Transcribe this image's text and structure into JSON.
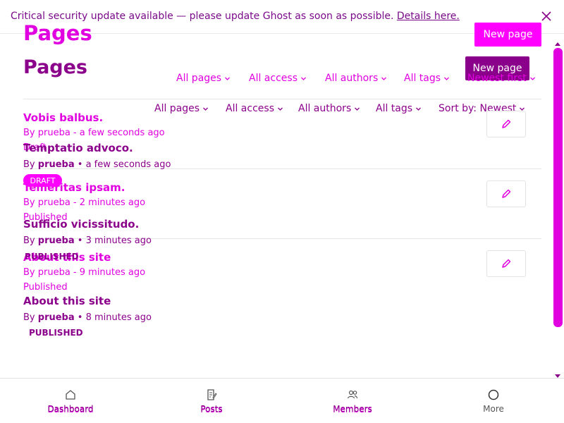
{
  "banner": {
    "message": "Critical security update available — please update Ghost as soon as possible.",
    "link": "Details here."
  },
  "header": {
    "title_a": "Pages",
    "title_b": "Pages",
    "new_page_a": "New page",
    "new_page_b": "New page"
  },
  "filters_a": [
    "All pages",
    "All access",
    "All authors",
    "All tags",
    "Newest first"
  ],
  "filters_b": [
    "All pages",
    "All access",
    "All authors",
    "All tags",
    "Sort by: Newest"
  ],
  "list_a": [
    {
      "title": "Vobis balbus.",
      "meta": "By prueba - a few seconds ago",
      "status": "Draft"
    },
    {
      "title": "Temeritas ipsam.",
      "meta": "By prueba - 2 minutes ago",
      "status": "Published"
    },
    {
      "title": "About this site",
      "meta": "By prueba - 9 minutes ago",
      "status": "Published"
    }
  ],
  "list_b": [
    {
      "title": "Temptatio advoco.",
      "by": "By",
      "author": "prueba",
      "time": "• a few seconds ago",
      "status": "DRAFT"
    },
    {
      "title": "Sufficio vicissitudo.",
      "by": "By",
      "author": "prueba",
      "time": "• 3 minutes ago",
      "status": "PUBLISHED"
    },
    {
      "title": "About this site",
      "by": "By",
      "author": "prueba",
      "time": "• 8 minutes ago",
      "status": "PUBLISHED"
    }
  ],
  "nav": [
    {
      "label": "Dashboard",
      "icon": "home-icon"
    },
    {
      "label": "Posts",
      "icon": "posts-icon"
    },
    {
      "label": "Members",
      "icon": "members-icon"
    },
    {
      "label": "More",
      "icon": "more-circle-icon"
    }
  ],
  "colors": {
    "accent_a": "#ff00ff",
    "accent_b": "#8b008b"
  }
}
